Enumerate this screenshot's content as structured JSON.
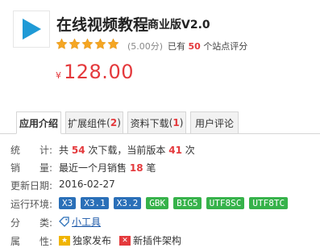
{
  "header": {
    "title": "在线视频教程",
    "edition": "商业版V2.0",
    "rating_score": "(5.00分)",
    "reviews_prefix": "已有",
    "reviews_count": "50",
    "reviews_suffix": "个站点评分",
    "price_symbol": "¥",
    "price": "128.00",
    "stars": 5,
    "logo_icon": "play-icon"
  },
  "tabs": [
    {
      "label": "应用介绍",
      "count": "",
      "active": true
    },
    {
      "label": "扩展组件",
      "count": "2",
      "active": false
    },
    {
      "label": "资料下载",
      "count": "1",
      "active": false
    },
    {
      "label": "用户评论",
      "count": "",
      "active": false
    }
  ],
  "info": {
    "stats_label": "统　　计:",
    "stats_prefix": "共",
    "stats_downloads": "54",
    "stats_mid": "次下载，当前版本",
    "stats_version_downloads": "41",
    "stats_suffix": "次",
    "sales_label": "销　　量:",
    "sales_prefix": "最近一个月销售",
    "sales_count": "18",
    "sales_suffix": "笔",
    "updated_label": "更新日期:",
    "updated_value": "2016-02-27",
    "env_label": "运行环境:",
    "env_badges": [
      {
        "text": "X3",
        "color": "blue"
      },
      {
        "text": "X3.1",
        "color": "blue"
      },
      {
        "text": "X3.2",
        "color": "blue"
      },
      {
        "text": "GBK",
        "color": "green"
      },
      {
        "text": "BIG5",
        "color": "green"
      },
      {
        "text": "UTF8SC",
        "color": "green"
      },
      {
        "text": "UTF8TC",
        "color": "green"
      }
    ],
    "category_label": "分　　类:",
    "category_value": "小工具",
    "attr_label": "属　　性:",
    "attr_items": [
      {
        "text": "独家发布",
        "icon": "exclusive-icon"
      },
      {
        "text": "新插件架构",
        "icon": "new-arch-icon"
      }
    ]
  },
  "colors": {
    "accent_red": "#e4393c",
    "star_orange": "#f5a623",
    "badge_blue": "#2a6fb8",
    "badge_green": "#36b24a",
    "logo_blue": "#1f9ad6"
  }
}
